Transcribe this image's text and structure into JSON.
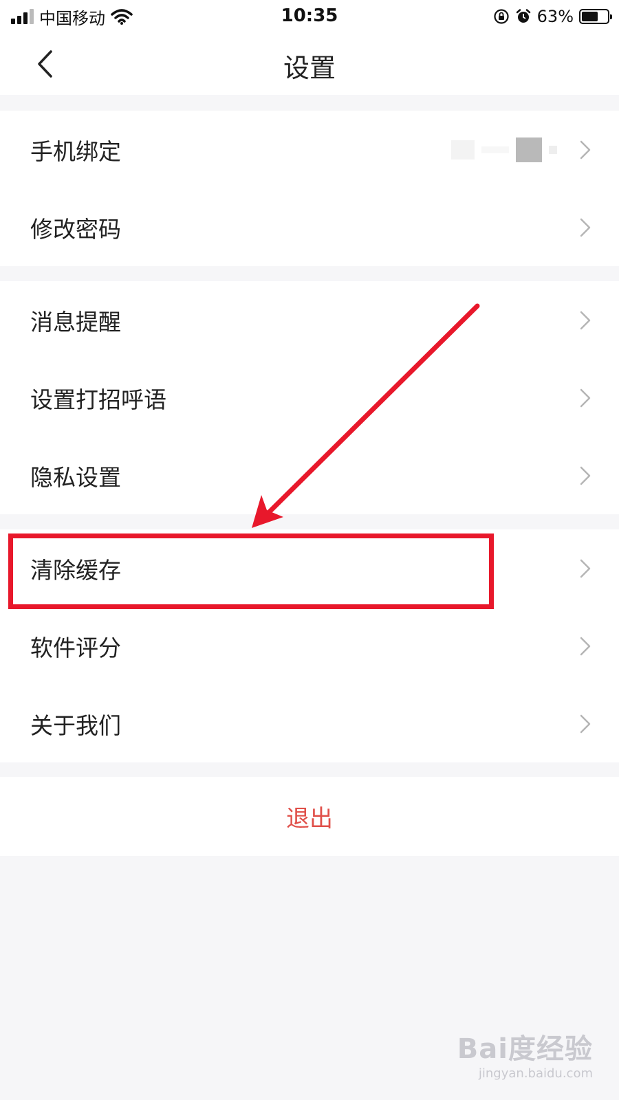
{
  "status_bar": {
    "carrier": "中国移动",
    "time": "10:35",
    "battery": "63%",
    "battery_level": 0.63
  },
  "nav": {
    "title": "设置",
    "back_icon": "chevron-left-icon"
  },
  "groups": [
    {
      "items": [
        {
          "label": "手机绑定",
          "has_value": true
        },
        {
          "label": "修改密码"
        }
      ]
    },
    {
      "items": [
        {
          "label": "消息提醒"
        },
        {
          "label": "设置打招呼语"
        },
        {
          "label": "隐私设置"
        }
      ]
    },
    {
      "items": [
        {
          "label": "清除缓存",
          "highlighted": true
        },
        {
          "label": "软件评分"
        },
        {
          "label": "关于我们"
        }
      ]
    }
  ],
  "logout": {
    "label": "退出"
  },
  "colors": {
    "logout_text": "#e0504a",
    "annotation": "#e8182b",
    "chevron": "#b5b5b5"
  },
  "watermark": {
    "logo": "Bai度经验",
    "url": "jingyan.baidu.com"
  }
}
